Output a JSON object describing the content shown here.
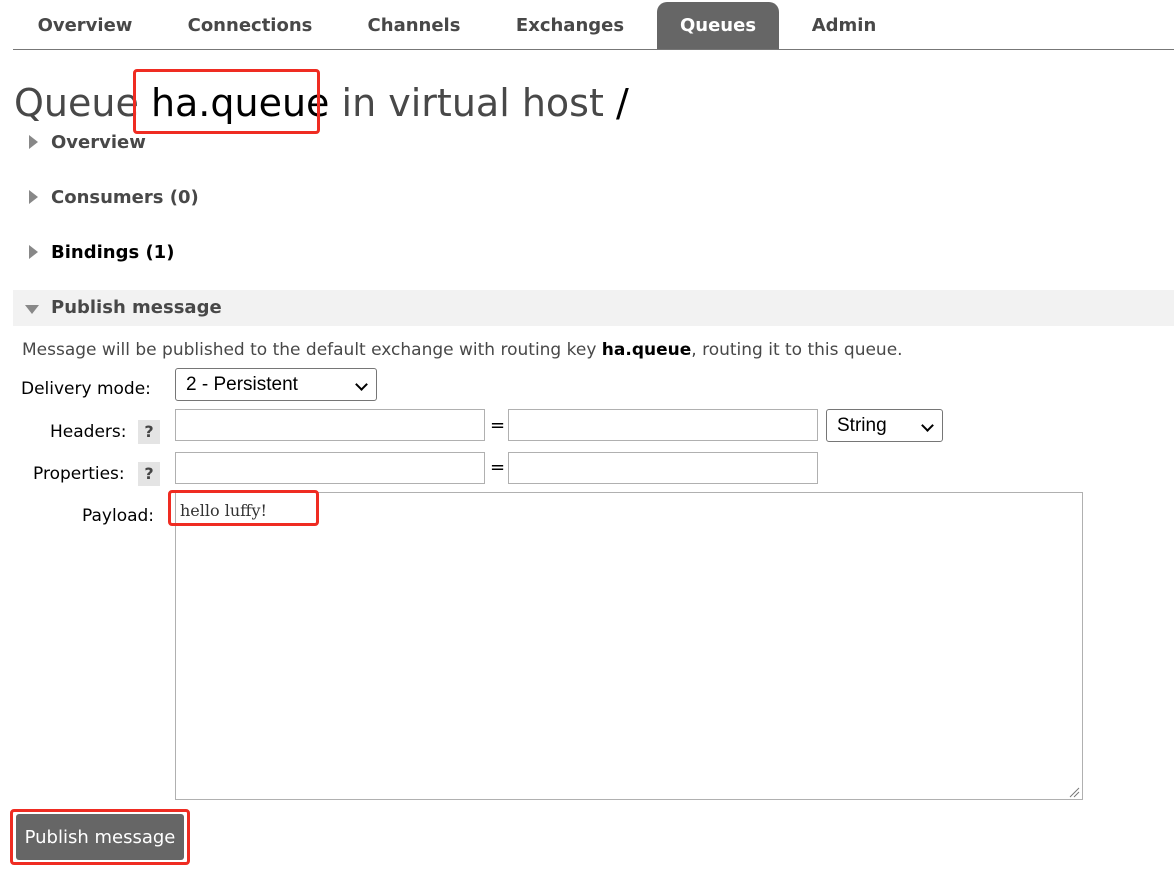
{
  "nav": {
    "tabs": [
      {
        "label": "Overview"
      },
      {
        "label": "Connections"
      },
      {
        "label": "Channels"
      },
      {
        "label": "Exchanges"
      },
      {
        "label": "Queues",
        "active": true
      },
      {
        "label": "Admin"
      }
    ]
  },
  "title": {
    "prefix": "Queue",
    "queue_name": "ha.queue",
    "middle": "in virtual host",
    "vhost": "/"
  },
  "sections": {
    "overview": {
      "label": "Overview",
      "expanded": false
    },
    "consumers": {
      "label": "Consumers (0)",
      "expanded": false
    },
    "bindings": {
      "label": "Bindings (1)",
      "expanded": false
    },
    "publish": {
      "label": "Publish message",
      "expanded": true
    }
  },
  "publish": {
    "intro_before": "Message will be published to the default exchange with routing key ",
    "routing_key": "ha.queue",
    "intro_after": ", routing it to this queue.",
    "delivery_mode_label": "Delivery mode:",
    "delivery_mode_value": "2 - Persistent",
    "headers_label": "Headers:",
    "headers_type_value": "String",
    "properties_label": "Properties:",
    "help_glyph": "?",
    "equals_glyph": "=",
    "payload_label": "Payload:",
    "payload_value": "hello luffy!",
    "submit_label": "Publish message"
  },
  "colors": {
    "highlight": "#ef2c22",
    "active_tab": "#666666",
    "button": "#666666"
  }
}
